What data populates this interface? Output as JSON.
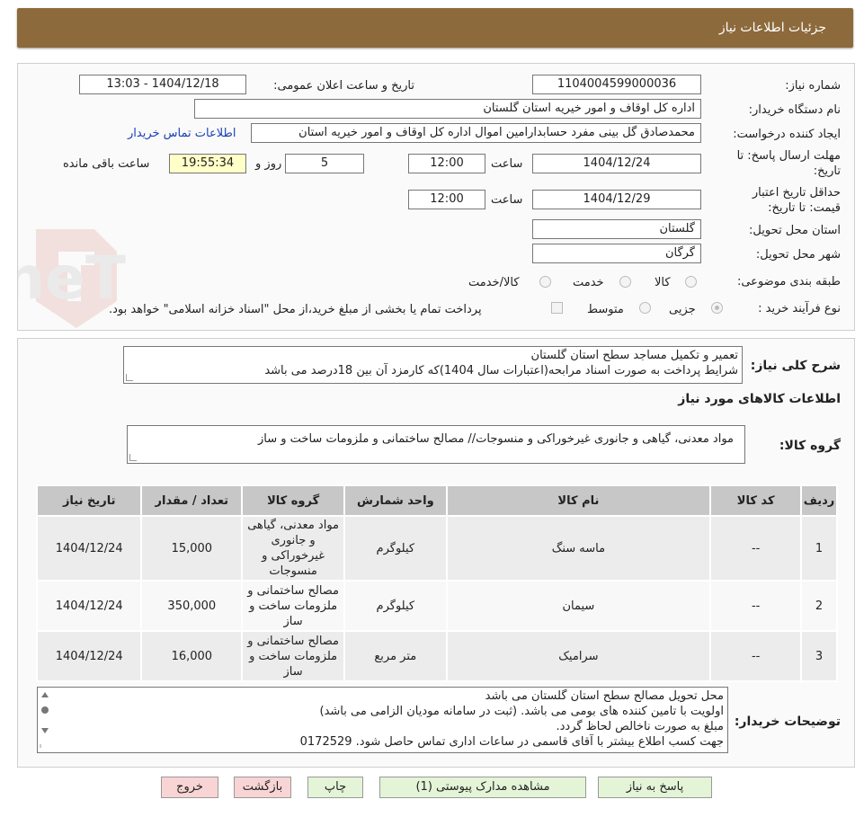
{
  "header": {
    "title": "جزئیات اطلاعات نیاز"
  },
  "form": {
    "need_number_label": "شماره نیاز:",
    "need_number": "1104004599000036",
    "announce_label": "تاریخ و ساعت اعلان عمومی:",
    "announce_value": "1404/12/18 - 13:03",
    "buyer_org_label": "نام دستگاه خریدار:",
    "buyer_org": "اداره کل اوقاف و امور خیریه استان گلستان",
    "creator_label": "ایجاد کننده درخواست:",
    "creator": "محمدصادق گل بینی مفرد حسابدارامین اموال اداره کل اوقاف و امور خیریه استان",
    "contact_link": "اطلاعات تماس خریدار",
    "deadline_label_1": "مهلت ارسال پاسخ: تا",
    "deadline_label_2": "تاریخ:",
    "deadline_date": "1404/12/24",
    "time_label": "ساعت",
    "deadline_time": "12:00",
    "days_value": "5",
    "days_label": "روز و",
    "remaining_time": "19:55:34",
    "remaining_label": "ساعت باقی مانده",
    "validity_label_1": "حداقل تاریخ اعتبار",
    "validity_label_2": "قیمت: تا تاریخ:",
    "validity_date": "1404/12/29",
    "validity_time": "12:00",
    "province_label": "استان محل تحویل:",
    "province": "گلستان",
    "city_label": "شهر محل تحویل:",
    "city": "گرگان",
    "category_label": "طبقه بندی موضوعی:",
    "category_options": [
      "کالا",
      "خدمت",
      "کالا/خدمت"
    ],
    "purchase_type_label": "نوع فرآیند خرید :",
    "purchase_options": [
      "جزیی",
      "متوسط"
    ],
    "purchase_note": "پرداخت تمام یا بخشی از مبلغ خرید،از محل \"اسناد خزانه اسلامی\" خواهد بود."
  },
  "summary": {
    "label": "شرح کلی نیاز:",
    "line1": "تعمیر و تکمیل مساجد سطح استان گلستان",
    "line2": "شرایط پرداخت به صورت اسناد مرابحه(اعتبارات سال 1404)که کارمزد آن بین 18درصد می باشد"
  },
  "goods_info": {
    "title": "اطلاعات کالاهای مورد نیاز",
    "group_label": "گروه کالا:",
    "group_value": "مواد معدنی، گیاهی و جانوری غیرخوراکی و منسوجات// مصالح ساختمانی و ملزومات ساخت و ساز"
  },
  "table": {
    "headers": [
      "ردیف",
      "کد کالا",
      "نام کالا",
      "واحد شمارش",
      "گروه کالا",
      "تعداد / مقدار",
      "تاریخ نیاز"
    ],
    "rows": [
      {
        "row": "1",
        "code": "--",
        "name": "ماسه سنگ",
        "unit": "کیلوگرم",
        "group": "مواد معدنی، گیاهی و جانوری غیرخوراکی و منسوجات",
        "qty": "15,000",
        "date": "1404/12/24"
      },
      {
        "row": "2",
        "code": "--",
        "name": "سیمان",
        "unit": "کیلوگرم",
        "group": "مصالح ساختمانی و ملزومات ساخت و ساز",
        "qty": "350,000",
        "date": "1404/12/24"
      },
      {
        "row": "3",
        "code": "--",
        "name": "سرامیک",
        "unit": "متر مربع",
        "group": "مصالح ساختمانی و ملزومات ساخت و ساز",
        "qty": "16,000",
        "date": "1404/12/24"
      }
    ]
  },
  "buyer_notes": {
    "label": "توضیحات خریدار:",
    "lines": [
      "محل تحویل مصالح سطح استان گلستان می باشد",
      "اولویت با تامین کننده های بومی می باشد. (ثبت در سامانه مودیان الزامی می باشد)",
      "مبلغ به صورت ناخالص لحاظ گردد.",
      "جهت کسب اطلاع بیشتر با آقای قاسمی در ساعات اداری تماس حاصل شود.  0172529"
    ]
  },
  "buttons": {
    "reply": "پاسخ به نیاز",
    "attachments": "مشاهده مدارک پیوستی (1)",
    "print": "چاپ",
    "back": "بازگشت",
    "exit": "خروج"
  },
  "watermark": {
    "text": "AriaTender.neT"
  }
}
